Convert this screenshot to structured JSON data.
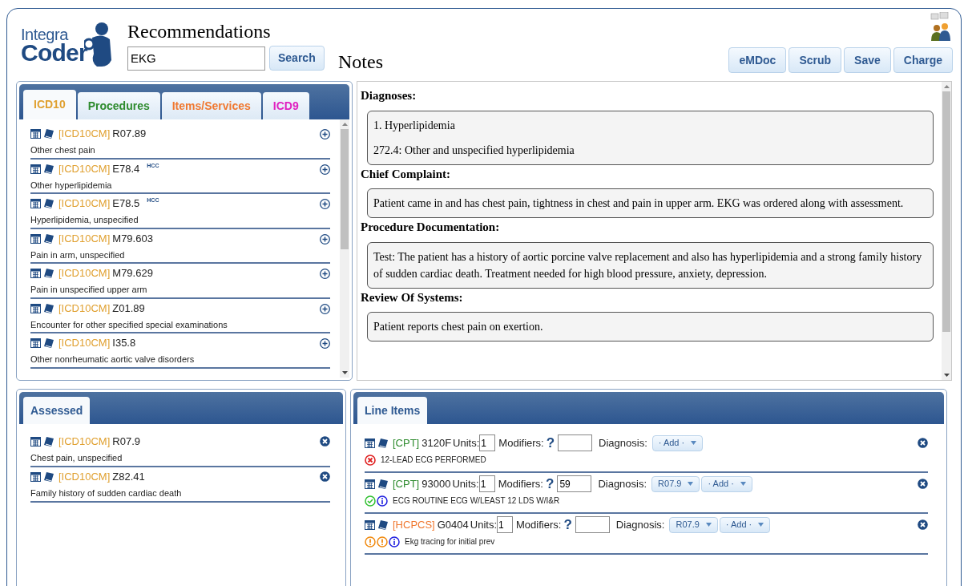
{
  "logo": {
    "line_1": "Integra",
    "line_2": "Coder"
  },
  "recommendations": {
    "title": "Recommendations",
    "search": {
      "value": "EKG"
    },
    "search_button": "Search",
    "tabs": [
      {
        "label": "ICD10",
        "selected": true,
        "color": "#e0a030"
      },
      {
        "label": "Procedures",
        "selected": false,
        "color": "#2e8b2e"
      },
      {
        "label": "Items/Services",
        "selected": false,
        "color": "#f07830"
      },
      {
        "label": "ICD9",
        "selected": false,
        "color": "#e020c0"
      }
    ],
    "items": [
      {
        "system": "[ICD10CM]",
        "code": "R07.89",
        "description": "Other chest pain"
      },
      {
        "system": "[ICD10CM]",
        "code": "E78.4",
        "badge": "HCC",
        "description": "Other hyperlipidemia"
      },
      {
        "system": "[ICD10CM]",
        "code": "E78.5",
        "badge": "HCC",
        "description": "Hyperlipidemia, unspecified"
      },
      {
        "system": "[ICD10CM]",
        "code": "M79.603",
        "description": "Pain in arm, unspecified"
      },
      {
        "system": "[ICD10CM]",
        "code": "M79.629",
        "description": "Pain in unspecified upper arm"
      },
      {
        "system": "[ICD10CM]",
        "code": "Z01.89",
        "description": "Encounter for other specified special examinations"
      },
      {
        "system": "[ICD10CM]",
        "code": "I35.8",
        "description": "Other nonrheumatic aortic valve disorders"
      }
    ]
  },
  "notes": {
    "title": "Notes",
    "buttons": [
      "eMDoc",
      "Scrub",
      "Save",
      "Charge"
    ],
    "sections": [
      {
        "heading": "Diagnoses:",
        "lines": [
          "1. Hyperlipidemia",
          "272.4: Other and unspecified hyperlipidemia"
        ]
      },
      {
        "heading": "Chief Complaint:",
        "lines": [
          "Patient came in and has chest pain, tightness in chest and pain in upper arm. EKG was ordered along with assessment."
        ]
      },
      {
        "heading": "Procedure Documentation:",
        "lines": [
          "Test: The patient has a history of aortic porcine valve replacement and also has hyperlipidemia and a strong family history of sudden cardiac death. Treatment needed for high blood pressure, anxiety, depression."
        ]
      },
      {
        "heading": "Review Of Systems:",
        "lines": [
          "Patient reports chest pain on exertion."
        ]
      }
    ]
  },
  "assessed": {
    "tab": "Assessed",
    "items": [
      {
        "system": "[ICD10CM]",
        "code": "R07.9",
        "description": "Chest pain, unspecified"
      },
      {
        "system": "[ICD10CM]",
        "code": "Z82.41",
        "description": "Family history of sudden cardiac death"
      }
    ]
  },
  "line_items": {
    "tab": "Line Items",
    "items": [
      {
        "system": "[CPT]",
        "color": "#2e8b2e",
        "code": "3120F",
        "units_label": "Units:",
        "units": "1",
        "modifiers_label": "Modifiers:",
        "help": "?",
        "diagnosis_label": "Diagnosis:",
        "diagnoses": [
          "· Add ·"
        ],
        "alerts": [
          {
            "kind": "error"
          }
        ],
        "description": "12-LEAD ECG PERFORMED"
      },
      {
        "system": "[CPT]",
        "color": "#2e8b2e",
        "code": "93000",
        "units_label": "Units:",
        "units": "1",
        "modifiers_label": "Modifiers:",
        "help": "?",
        "modifier": "59",
        "diagnosis_label": "Diagnosis:",
        "diagnoses": [
          "R07.9",
          "· Add ·"
        ],
        "alerts": [
          {
            "kind": "ok"
          },
          {
            "kind": "info"
          }
        ],
        "description": "ECG ROUTINE ECG W/LEAST 12 LDS W/I&R"
      },
      {
        "system": "[HCPCS]",
        "color": "#f07830",
        "code": "G0404",
        "units_label": "Units:",
        "units": "1",
        "modifiers_label": "Modifiers:",
        "help": "?",
        "diagnosis_label": "Diagnosis:",
        "diagnoses": [
          "R07.9",
          "· Add ·"
        ],
        "alerts": [
          {
            "kind": "warning"
          },
          {
            "kind": "warning"
          },
          {
            "kind": "info"
          }
        ],
        "description": "Ekg tracing for initial prev"
      }
    ]
  }
}
